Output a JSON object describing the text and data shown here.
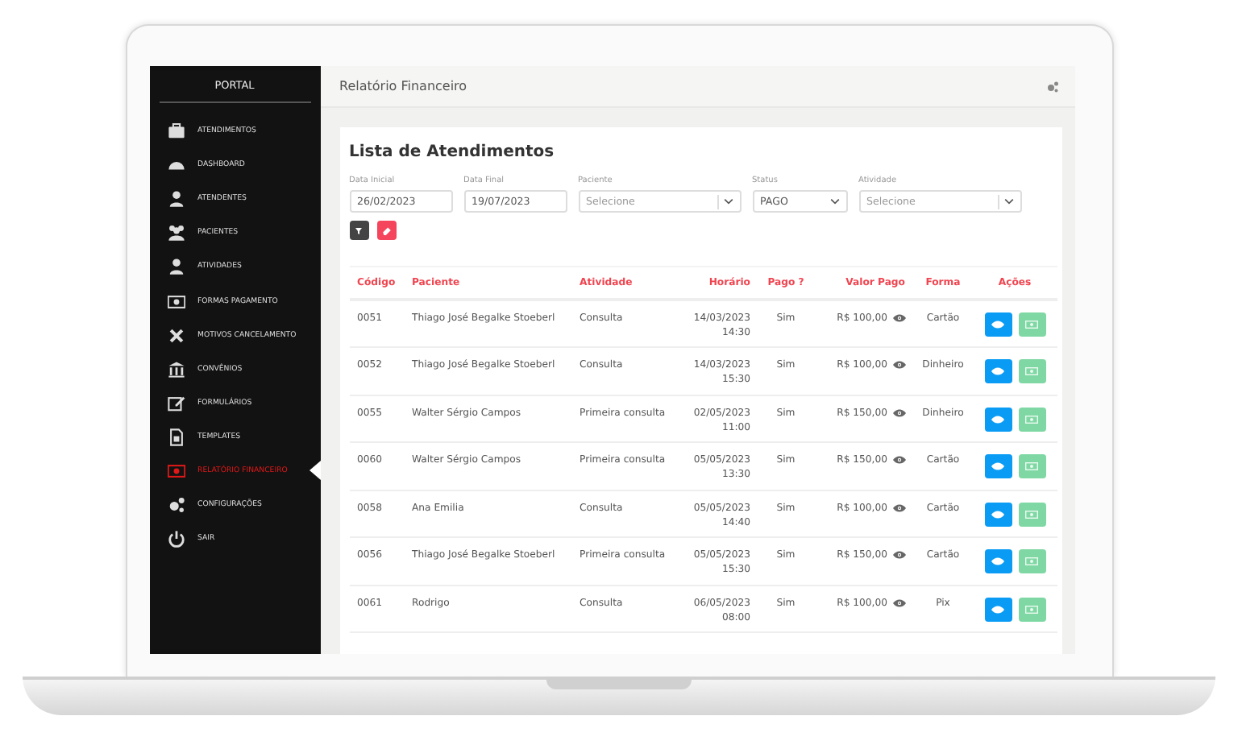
{
  "sidebar": {
    "title": "PORTAL",
    "items": [
      {
        "label": "ATENDIMENTOS",
        "selected": false
      },
      {
        "label": "DASHBOARD",
        "selected": false
      },
      {
        "label": "ATENDENTES",
        "selected": false
      },
      {
        "label": "PACIENTES",
        "selected": false
      },
      {
        "label": "ATIVIDADES",
        "selected": false
      },
      {
        "label": "FORMAS PAGAMENTO",
        "selected": false
      },
      {
        "label": "MOTIVOS CANCELAMENTO",
        "selected": false
      },
      {
        "label": "CONVÊNIOS",
        "selected": false
      },
      {
        "label": "FORMULÁRIOS",
        "selected": false
      },
      {
        "label": "TEMPLATES",
        "selected": false
      },
      {
        "label": "RELATÓRIO FINANCEIRO",
        "selected": true
      },
      {
        "label": "CONFIGURAÇÕES",
        "selected": false
      },
      {
        "label": "SAIR",
        "selected": false
      }
    ]
  },
  "header": {
    "title": "Relatório Financeiro"
  },
  "card": {
    "title": "Lista de Atendimentos",
    "filters": [
      {
        "kind": "date",
        "label": "Data Inicial",
        "value": "26/02/2023"
      },
      {
        "kind": "date",
        "label": "Data Final",
        "value": "19/07/2023"
      },
      {
        "kind": "combo",
        "label": "Paciente",
        "placeholder": "Selecione"
      },
      {
        "kind": "select",
        "label": "Status",
        "value": "PAGO"
      },
      {
        "kind": "combo",
        "label": "Atividade",
        "placeholder": "Selecione"
      }
    ],
    "table": {
      "columns": [
        "Código",
        "Paciente",
        "Atividade",
        "Horário",
        "Pago ?",
        "Valor Pago",
        "Forma",
        "Ações"
      ],
      "rows": [
        {
          "code": "0051",
          "patient": "Thiago José Begalke Stoeberl",
          "activity": "Consulta",
          "date": "14/03/2023",
          "time": "14:30",
          "paid": "Sim",
          "amount": "R$ 100,00",
          "method": "Cartão"
        },
        {
          "code": "0052",
          "patient": "Thiago José Begalke Stoeberl",
          "activity": "Consulta",
          "date": "14/03/2023",
          "time": "15:30",
          "paid": "Sim",
          "amount": "R$ 100,00",
          "method": "Dinheiro"
        },
        {
          "code": "0055",
          "patient": "Walter Sérgio Campos",
          "activity": "Primeira consulta",
          "date": "02/05/2023",
          "time": "11:00",
          "paid": "Sim",
          "amount": "R$ 150,00",
          "method": "Dinheiro"
        },
        {
          "code": "0060",
          "patient": "Walter Sérgio Campos",
          "activity": "Primeira consulta",
          "date": "05/05/2023",
          "time": "13:30",
          "paid": "Sim",
          "amount": "R$ 150,00",
          "method": "Cartão"
        },
        {
          "code": "0058",
          "patient": "Ana Emilia",
          "activity": "Consulta",
          "date": "05/05/2023",
          "time": "14:40",
          "paid": "Sim",
          "amount": "R$ 100,00",
          "method": "Cartão"
        },
        {
          "code": "0056",
          "patient": "Thiago José Begalke Stoeberl",
          "activity": "Primeira consulta",
          "date": "05/05/2023",
          "time": "15:30",
          "paid": "Sim",
          "amount": "R$ 150,00",
          "method": "Cartão"
        },
        {
          "code": "0061",
          "patient": "Rodrigo",
          "activity": "Consulta",
          "date": "06/05/2023",
          "time": "08:00",
          "paid": "Sim",
          "amount": "R$ 100,00",
          "method": "Pix"
        }
      ]
    }
  }
}
